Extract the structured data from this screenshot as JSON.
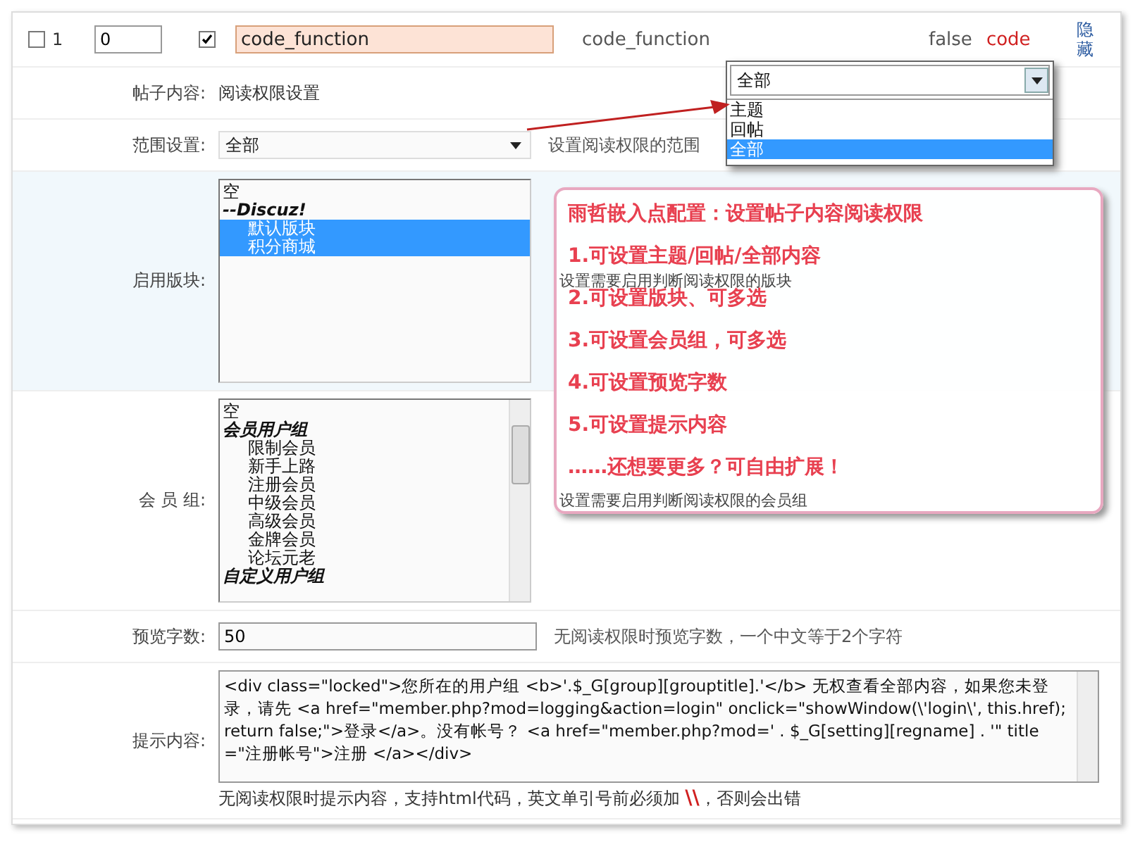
{
  "top_row": {
    "checked": false,
    "number": "1",
    "order": "0",
    "enabled": true,
    "name_value": "code_function",
    "name_text": "code_function",
    "value": "false",
    "type": "code",
    "action": "隐藏"
  },
  "form_rows": [
    {
      "kind": "text",
      "label": "帖子内容:",
      "value": "阅读权限设置"
    },
    {
      "kind": "select",
      "label": "范围设置:",
      "value": "全部",
      "hint": "设置阅读权限的范围"
    },
    {
      "kind": "listbox",
      "label": "启用版块:",
      "scrollbar": false,
      "hint": "设置需要启用判断阅读权限的版块",
      "options": [
        {
          "kind": "option",
          "text": "空",
          "selected": false
        },
        {
          "kind": "group",
          "text": "--Discuz!",
          "selected": false
        },
        {
          "kind": "child",
          "text": "默认版块",
          "selected": true
        },
        {
          "kind": "child",
          "text": "积分商城",
          "selected": true
        }
      ]
    },
    {
      "kind": "listbox",
      "label": "会 员 组:",
      "scrollbar": true,
      "hint": "设置需要启用判断阅读权限的会员组",
      "options": [
        {
          "kind": "option",
          "text": "空",
          "selected": false
        },
        {
          "kind": "group",
          "text": "会员用户组",
          "selected": false
        },
        {
          "kind": "child",
          "text": "限制会员",
          "selected": false
        },
        {
          "kind": "child",
          "text": "新手上路",
          "selected": false
        },
        {
          "kind": "child",
          "text": "注册会员",
          "selected": false
        },
        {
          "kind": "child",
          "text": "中级会员",
          "selected": false
        },
        {
          "kind": "child",
          "text": "高级会员",
          "selected": false
        },
        {
          "kind": "child",
          "text": "金牌会员",
          "selected": false
        },
        {
          "kind": "child",
          "text": "论坛元老",
          "selected": false
        },
        {
          "kind": "group",
          "text": "自定义用户组",
          "selected": false
        }
      ]
    },
    {
      "kind": "input",
      "label": "预览字数:",
      "value": "50",
      "hint": "无阅读权限时预览字数，一个中文等于2个字符"
    },
    {
      "kind": "textarea",
      "label": "提示内容:",
      "value": "<div class=\"locked\">您所在的用户组 <b>'.$_G[group][grouptitle].'</b> 无权查看全部内容，如果您未登录，请先 <a href=\"member.php?mod=logging&action=login\" onclick=\"showWindow(\\'login\\', this.href);return false;\">登录</a>。没有帐号？ <a href=\"member.php?mod=' . $_G[setting][regname] . '\" title=\"注册帐号\">注册 </a></div>",
      "hint": "无阅读权限时提示内容，支持html代码，英文单引号前必须加 **\\\\**，否则会出错"
    }
  ],
  "dropdown_popup": {
    "value": "全部",
    "options": [
      {
        "text": "主题",
        "selected": false
      },
      {
        "text": "回帖",
        "selected": false
      },
      {
        "text": "全部",
        "selected": true
      }
    ]
  },
  "callout": {
    "title": "雨哲嵌入点配置：设置帖子内容阅读权限",
    "lines": [
      "1.可设置主题/回帖/全部内容",
      "2.可设置版块、可多选",
      "3.可设置会员组，可多选",
      "4.可设置预览字数",
      "5.可设置提示内容",
      "……还想要更多？可自由扩展！"
    ]
  }
}
